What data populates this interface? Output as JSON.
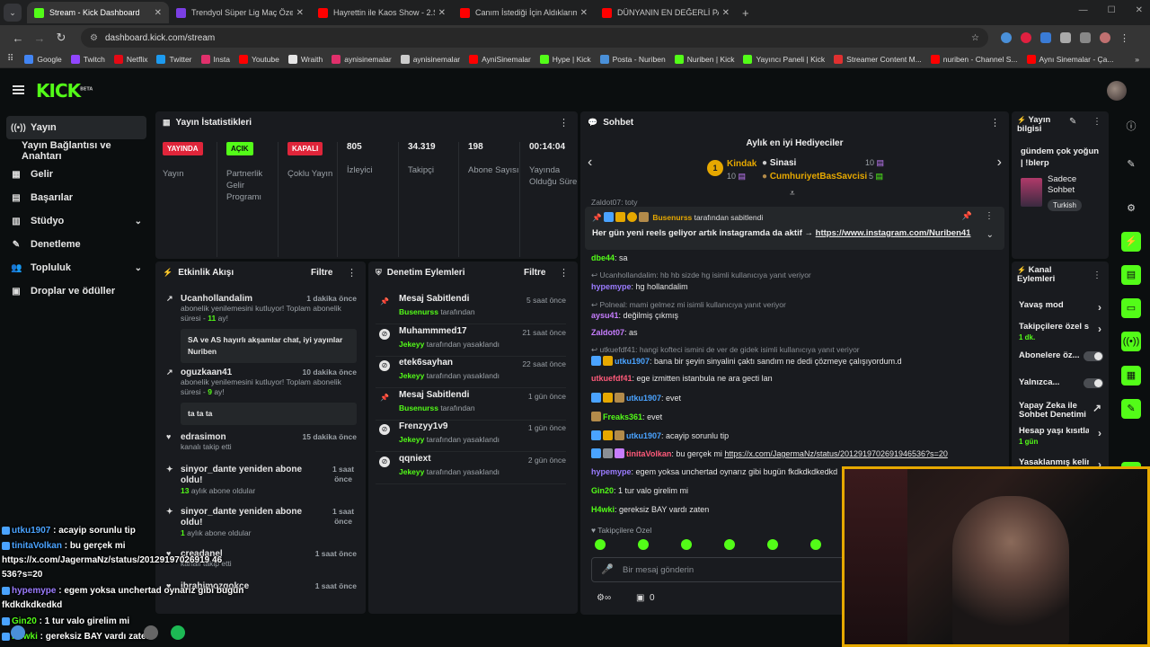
{
  "browser": {
    "tabs": [
      {
        "title": "Stream - Kick Dashboard",
        "color": "#53fc18",
        "active": true
      },
      {
        "title": "Trendyol Süper Lig Maç Özetleri",
        "color": "#7b3fe4"
      },
      {
        "title": "Hayrettin ile Kaos Show - 2.Sez",
        "color": "#ff0000"
      },
      {
        "title": "Canım İstediği İçin Aldıklarım! 1",
        "color": "#ff0000"
      },
      {
        "title": "DÜNYANIN EN DEĞERLİ PASPAS",
        "color": "#ff0000"
      }
    ],
    "url": "dashboard.kick.com/stream",
    "bookmarks": [
      {
        "label": "Google",
        "color": "#4285f4"
      },
      {
        "label": "Twitch",
        "color": "#9146ff"
      },
      {
        "label": "Netflix",
        "color": "#e50914"
      },
      {
        "label": "Twitter",
        "color": "#1d9bf0"
      },
      {
        "label": "Insta",
        "color": "#e1306c"
      },
      {
        "label": "Youtube",
        "color": "#ff0000"
      },
      {
        "label": "Wraith",
        "color": "#e6e6e6"
      },
      {
        "label": "aynisinemalar",
        "color": "#e1306c"
      },
      {
        "label": "aynisinemalar",
        "color": "#cccccc"
      },
      {
        "label": "AyniSinemalar",
        "color": "#ff0000"
      },
      {
        "label": "Hype | Kick",
        "color": "#53fc18"
      },
      {
        "label": "Posta - Nuriben",
        "color": "#4a90d9"
      },
      {
        "label": "Nuriben | Kick",
        "color": "#53fc18"
      },
      {
        "label": "Yayıncı Paneli | Kick",
        "color": "#53fc18"
      },
      {
        "label": "Streamer Content M...",
        "color": "#e03030"
      },
      {
        "label": "nuriben - Channel S...",
        "color": "#ff0000"
      },
      {
        "label": "Aynı Sinemalar - Ça...",
        "color": "#ff0000"
      }
    ]
  },
  "kick": {
    "logo": "KICK",
    "logo_sup": "BETA"
  },
  "sidebar": {
    "items": [
      {
        "label": "Yayın",
        "icon": "broadcast-icon",
        "glyph": "((•))",
        "active": true
      },
      {
        "label": "Yayın Bağlantısı ve Anahtarı",
        "icon": "",
        "glyph": ""
      },
      {
        "label": "Gelir",
        "icon": "revenue-icon",
        "glyph": "▦"
      },
      {
        "label": "Başarılar",
        "icon": "achievements-icon",
        "glyph": "▤"
      },
      {
        "label": "Stüdyo",
        "icon": "studio-icon",
        "glyph": "▥",
        "chevron": "⌄"
      },
      {
        "label": "Denetleme",
        "icon": "wrench-icon",
        "glyph": "✎"
      },
      {
        "label": "Topluluk",
        "icon": "community-icon",
        "glyph": "👥",
        "chevron": "⌄"
      },
      {
        "label": "Droplar ve ödüller",
        "icon": "drops-icon",
        "glyph": "▣"
      }
    ]
  },
  "stats": {
    "title": "Yayın İstatistikleri",
    "items": [
      {
        "badge": "YAYINDA",
        "badge_type": "red",
        "label": "Yayın"
      },
      {
        "badge": "AÇIK",
        "badge_type": "green",
        "label": "Partnerlik Gelir Programı"
      },
      {
        "badge": "KAPALI",
        "badge_type": "red",
        "label": "Çoklu Yayın"
      },
      {
        "value": "805",
        "label": "İzleyici"
      },
      {
        "value": "34.319",
        "label": "Takipçi"
      },
      {
        "value": "198",
        "label": "Abone Sayısı"
      },
      {
        "value": "00:14:04",
        "label": "Yayında Olduğu Süre"
      }
    ]
  },
  "activity": {
    "title": "Etkinlik Akışı",
    "filter": "Filtre",
    "items": [
      {
        "name": "Ucanhollandalim",
        "time": "1 dakika önce",
        "desc_a": "abonelik yenilemesini kutluyor! Toplam abonelik süresi - ",
        "desc_b": "11",
        "desc_c": " ay!",
        "msg": "SA ve AS hayırlı akşamlar chat, iyi yayınlar Nuriben"
      },
      {
        "name": "oguzkaan41",
        "time": "10 dakika önce",
        "desc_a": "abonelik yenilemesini kutluyor! Toplam abonelik süresi - ",
        "desc_b": "9",
        "desc_c": " ay!",
        "msg": "ta ta ta"
      },
      {
        "name": "edrasimon",
        "time": "15 dakika önce",
        "desc_a": "kanalı takip etti"
      },
      {
        "name": "sinyor_dante yeniden abone oldu!",
        "time": "1 saat önce",
        "desc_b": "13",
        "desc_c": " aylık abone oldular"
      },
      {
        "name": "sinyor_dante yeniden abone oldu!",
        "time": "1 saat önce",
        "desc_b": "1",
        "desc_c": " aylık abone oldular"
      },
      {
        "name": "creadanel",
        "time": "1 saat önce",
        "desc_a": "kanalı takip etti"
      },
      {
        "name": "ibrahimozgokce",
        "time": "1 saat önce",
        "desc_a": ""
      }
    ]
  },
  "moderation": {
    "title": "Denetim Eylemleri",
    "filter": "Filtre",
    "by": "tarafından",
    "items": [
      {
        "action": "Mesaj Sabitlendi",
        "user": "Busenurss",
        "suffix": "tarafından",
        "time": "5 saat önce",
        "icon": "pin"
      },
      {
        "action": "Muhammmed17",
        "user": "Jekeyy",
        "suffix": "tarafından yasaklandı",
        "time": "21 saat önce",
        "icon": "ban"
      },
      {
        "action": "etek6sayhan",
        "user": "Jekeyy",
        "suffix": "tarafından yasaklandı",
        "time": "22 saat önce",
        "icon": "ban"
      },
      {
        "action": "Mesaj Sabitlendi",
        "user": "Busenurss",
        "suffix": "tarafından",
        "time": "1 gün önce",
        "icon": "pin"
      },
      {
        "action": "Frenzyy1v9",
        "user": "Jekeyy",
        "suffix": "tarafından yasaklandı",
        "time": "1 gün önce",
        "icon": "ban"
      },
      {
        "action": "qqniext",
        "user": "Jekeyy",
        "suffix": "tarafından yasaklandı",
        "time": "2 gün önce",
        "icon": "ban"
      }
    ]
  },
  "chat": {
    "title": "Sohbet",
    "gifters_title": "Aylık en iyi Hediyeciler",
    "gifters": [
      {
        "rank": "1",
        "name": "Kindak",
        "count": "10"
      },
      {
        "name": "Sinasi",
        "count": "10"
      },
      {
        "name": "CumhuriyetBasSavcisi",
        "count": "5"
      }
    ],
    "scrolled_fragment": "Zaldot07: toty",
    "pinned_by": "Busenurss",
    "pinned_by_suffix": "tarafından sabitlendi",
    "pinned_text": "Her gün yeni reels geliyor artık instagramda da aktif →",
    "pinned_link": "https://www.instagram.com/Nuriben41",
    "messages": [
      {
        "type": "msg",
        "user": "dbe44",
        "color": "#53fc18",
        "text": "sa"
      },
      {
        "type": "reply",
        "text": "Ucanhollandalim: hb hb sizde hg isimli kullanıcıya yanıt veriyor"
      },
      {
        "type": "msg",
        "user": "hypemype",
        "color": "#9b7cff",
        "text": "hg hollandalim"
      },
      {
        "type": "reply",
        "text": "Polneal: mami gelmez mi isimli kullanıcıya yanıt veriyor"
      },
      {
        "type": "msg",
        "user": "aysu41",
        "color": "#c77dff",
        "text": "değilmiş çıkmış"
      },
      {
        "type": "msg",
        "user": "Zaldot07",
        "color": "#c77dff",
        "text": "as"
      },
      {
        "type": "reply",
        "text": "utkuefdf41: hangi kofteci ismini de ver de gidek isimli kullanıcıya yanıt veriyor"
      },
      {
        "type": "msg",
        "user": "utku1907",
        "color": "#4aa3ff",
        "text": "bana bir şeyin sinyalini çaktı sandım ne dedi çözmeye çalışıyordum.d",
        "badges": [
          "#4aa3ff",
          "#e6a800"
        ]
      },
      {
        "type": "msg",
        "user": "utkuefdf41",
        "color": "#ff5a7a",
        "text": "ege izmitten istanbula ne ara gecti lan"
      },
      {
        "type": "msg",
        "user": "utku1907",
        "color": "#4aa3ff",
        "text": "evet",
        "badges": [
          "#4aa3ff",
          "#e6a800",
          "#b38b4a"
        ]
      },
      {
        "type": "msg",
        "user": "Freaks361",
        "color": "#53fc18",
        "text": "evet",
        "badges": [
          "#b38b4a"
        ]
      },
      {
        "type": "msg",
        "user": "utku1907",
        "color": "#4aa3ff",
        "text": "acayip sorunlu tip",
        "badges": [
          "#4aa3ff",
          "#e6a800",
          "#b38b4a"
        ]
      },
      {
        "type": "msg",
        "user": "tinitaVolkan",
        "color": "#ff5a7a",
        "text": "bu gerçek mi",
        "link": "https://x.com/JagermaNz/status/2012919702691946536?s=20",
        "badges": [
          "#4aa3ff",
          "#8a8f95",
          "#c77dff"
        ]
      },
      {
        "type": "msg",
        "user": "hypemype",
        "color": "#9b7cff",
        "text": "egem yoksa unchertad oynarız gibi bugün fkdkdkdkedkd"
      },
      {
        "type": "msg",
        "user": "Gin20",
        "color": "#53fc18",
        "text": "1 tur valo girelim mi"
      },
      {
        "type": "msg",
        "user": "H4wki",
        "color": "#53fc18",
        "text": "gereksiz BAY vardı zaten"
      }
    ],
    "followers_only": "Takipçilere Özel",
    "input_placeholder": "Bir mesaj gönderin",
    "points": "0"
  },
  "stream_info": {
    "title": "Yayın bilgisi",
    "stream_title": "gündem çok yoğun | !blerp",
    "category": "Sadece Sohbet",
    "tag": "Turkish"
  },
  "channel_actions": {
    "title": "Kanal Eylemleri",
    "items": [
      {
        "label": "Yavaş mod",
        "kind": "chevron"
      },
      {
        "label": "Takipçilere özel s",
        "sub": "1 dk.",
        "kind": "chevron"
      },
      {
        "label": "Abonelere öz...",
        "kind": "toggle"
      },
      {
        "label": "Yalnızca...",
        "kind": "toggle"
      },
      {
        "label": "Yapay Zeka ile Sohbet Denetimi",
        "kind": "external"
      },
      {
        "label": "Hesap yaşı kısıtla",
        "sub": "1 gün",
        "kind": "chevron"
      },
      {
        "label": "Yasaklanmış kelim",
        "kind": "chevron"
      }
    ]
  },
  "overlay": {
    "lines": [
      {
        "user": "utku1907",
        "color": "#4aa3ff",
        "text": " : acayip sorunlu tip"
      },
      {
        "user": "tinitaVolkan",
        "color": "#4aa3ff",
        "text": " : bu gerçek mi"
      },
      {
        "user": "",
        "color": "#ffffff",
        "text": "https://x.com/JagermaNz/status/20129197026919 46"
      },
      {
        "user": "",
        "color": "#ffffff",
        "text": "536?s=20"
      },
      {
        "user": "hypemype",
        "color": "#9b7cff",
        "text": " : egem yoksa unchertad oynarız gibi bugün"
      },
      {
        "user": "",
        "color": "#ffffff",
        "text": "fkdkdkdkedkd"
      },
      {
        "user": "Gin20",
        "color": "#53fc18",
        "text": " : 1 tur valo girelim mi"
      },
      {
        "user": "H4wki",
        "color": "#53fc18",
        "text": " : gereksiz BAY vardı zaten"
      }
    ]
  }
}
